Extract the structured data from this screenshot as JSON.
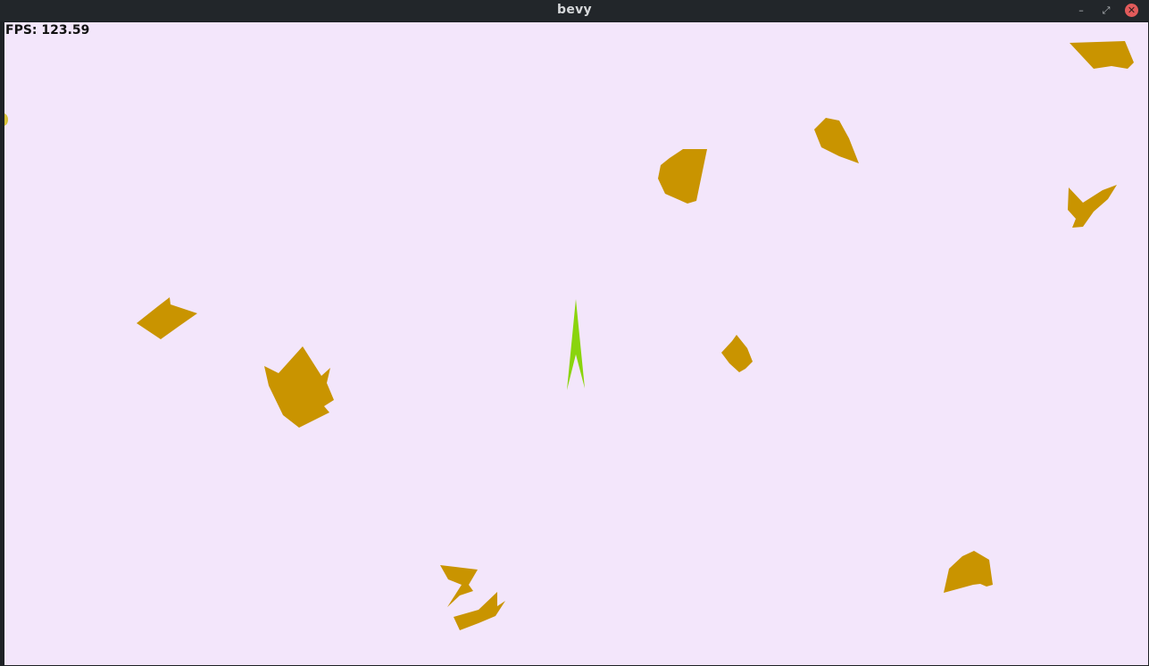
{
  "window": {
    "title": "bevy"
  },
  "controls": {
    "minimize": "–",
    "maximize": "⤢",
    "close": "✕"
  },
  "hud": {
    "fps_text": "FPS: 123.59"
  },
  "colors": {
    "background": "#f3e6fb",
    "asteroid": "#c99400",
    "ship": "#8ad40d"
  }
}
